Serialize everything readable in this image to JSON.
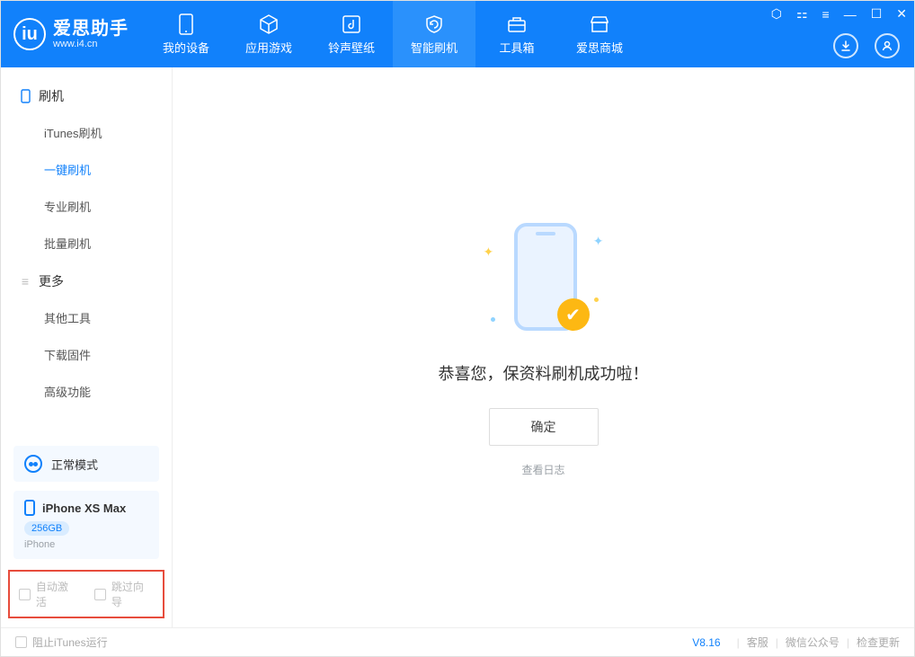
{
  "app": {
    "title": "爱思助手",
    "subtitle": "www.i4.cn"
  },
  "tabs": [
    {
      "label": "我的设备"
    },
    {
      "label": "应用游戏"
    },
    {
      "label": "铃声壁纸"
    },
    {
      "label": "智能刷机"
    },
    {
      "label": "工具箱"
    },
    {
      "label": "爱思商城"
    }
  ],
  "sidebar": {
    "group1": {
      "title": "刷机",
      "items": [
        "iTunes刷机",
        "一键刷机",
        "专业刷机",
        "批量刷机"
      ]
    },
    "group2": {
      "title": "更多",
      "items": [
        "其他工具",
        "下载固件",
        "高级功能"
      ]
    }
  },
  "mode": {
    "label": "正常模式"
  },
  "device": {
    "name": "iPhone XS Max",
    "storage": "256GB",
    "type": "iPhone"
  },
  "options": {
    "auto_activate": "自动激活",
    "skip_guide": "跳过向导"
  },
  "main": {
    "success_text": "恭喜您，保资料刷机成功啦！",
    "ok_button": "确定",
    "view_log": "查看日志"
  },
  "footer": {
    "block_itunes": "阻止iTunes运行",
    "version": "V8.16",
    "links": [
      "客服",
      "微信公众号",
      "检查更新"
    ]
  }
}
